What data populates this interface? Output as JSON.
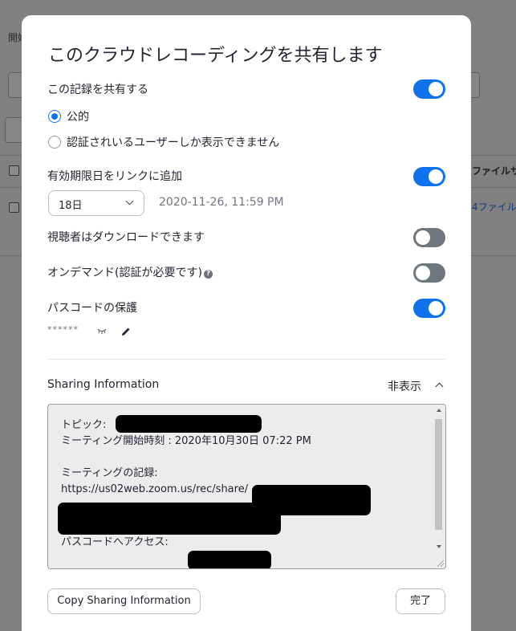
{
  "background": {
    "label": "開始",
    "column_header": "ファイルサイズ",
    "file_link": "4ファイル"
  },
  "modal": {
    "title": "このクラウドレコーディングを共有します",
    "share_toggle": {
      "label": "この記録を共有する",
      "on": true
    },
    "visibility": {
      "options": [
        {
          "label": "公的",
          "checked": true
        },
        {
          "label": "認証されいるユーザーしか表示できません",
          "checked": false
        }
      ]
    },
    "expiry": {
      "label": "有効期限日をリンクに追加",
      "on": true,
      "selected": "18日",
      "date": "2020-11-26, 11:59 PM"
    },
    "download": {
      "label": "視聴者はダウンロードできます",
      "on": false
    },
    "on_demand": {
      "label": "オンデマンド(認証が必要です)",
      "on": false,
      "help_icon": "question-circle-icon"
    },
    "passcode": {
      "label": "パスコードの保護",
      "on": true,
      "masked": "******",
      "reveal_icon": "eye-closed-icon",
      "edit_icon": "pencil-icon"
    },
    "sharing_info": {
      "title": "Sharing Information",
      "toggle_label": "非表示",
      "lines": {
        "topic": "トピック:",
        "start_time": "ミーティング開始時刻 : 2020年10月30日 07:22 PM",
        "recording_label": "ミーティングの記録:",
        "recording_url": "https://us02web.zoom.us/rec/share/",
        "passcode_access": "パスコードへアクセス:"
      }
    },
    "buttons": {
      "copy": "Copy Sharing Information",
      "done": "完了"
    },
    "colors": {
      "accent": "#0e72ed",
      "toggle_off": "#6e7680"
    }
  }
}
